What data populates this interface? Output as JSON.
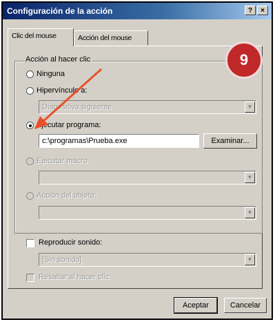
{
  "window": {
    "title": "Configuración de la acción",
    "help_glyph": "?",
    "close_glyph": "×"
  },
  "tabs": [
    {
      "label": "Clic del mouse"
    },
    {
      "label": "Acción del mouse"
    }
  ],
  "group": {
    "legend": "Acción al hacer clic"
  },
  "options": {
    "ninguna": "Ninguna",
    "hipervinculo": "Hipervínculo a:",
    "hipervinculo_value": "Diapositiva siguiente",
    "ejecutar": "Ejecutar programa:",
    "ejecutar_value": "c:\\programas\\Prueba.exe",
    "examinar": "Examinar...",
    "macro": "Ejecutar macro:",
    "accion_objeto": "Acción del objeto:"
  },
  "sound": {
    "label": "Reproducir sonido:",
    "value": "[Sin sonido]"
  },
  "resaltar": {
    "label": "Resaltar al hacer clic"
  },
  "buttons": {
    "aceptar": "Aceptar",
    "cancelar": "Cancelar"
  },
  "annotation": {
    "step_number": "9"
  },
  "colors": {
    "titlebar": "#0a246a",
    "badge": "#c0282a",
    "arrow": "#e8502a"
  }
}
